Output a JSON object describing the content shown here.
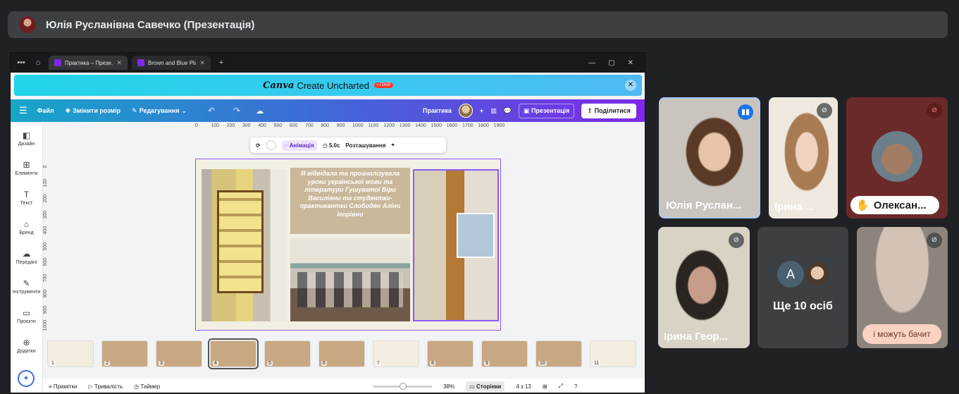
{
  "meet": {
    "presenter_title": "Юлія Русланівна Савечко (Презентація)"
  },
  "browser": {
    "tabs": [
      {
        "label": "Практика – Презе..."
      },
      {
        "label": "Brown and Blue Pla..."
      }
    ]
  },
  "promo": {
    "brand": "Canva",
    "text": "Create Uncharted",
    "badge": "• ГРАЙ"
  },
  "canva_toolbar": {
    "file": "Файл",
    "resize": "Змінити розмір",
    "edit": "Редагування",
    "doc_name": "Практика",
    "present": "Презентація",
    "share": "Поділитися"
  },
  "sidebar": {
    "items": [
      {
        "label": "Дизайн",
        "icon": "design-icon"
      },
      {
        "label": "Елементи",
        "icon": "elements-icon"
      },
      {
        "label": "Текст",
        "icon": "text-icon"
      },
      {
        "label": "Бренд",
        "icon": "brand-icon"
      },
      {
        "label": "Передані",
        "icon": "uploads-icon"
      },
      {
        "label": "Інструменти",
        "icon": "tools-icon"
      },
      {
        "label": "Проєкти",
        "icon": "projects-icon"
      },
      {
        "label": "Додатки",
        "icon": "apps-icon"
      }
    ]
  },
  "ruler": {
    "h": [
      "0",
      "100",
      "200",
      "300",
      "400",
      "500",
      "600",
      "700",
      "800",
      "900",
      "1000",
      "1100",
      "1200",
      "1300",
      "1400",
      "1500",
      "1600",
      "1700",
      "1800",
      "1900"
    ],
    "v": [
      "0",
      "100",
      "200",
      "300",
      "400",
      "500",
      "600",
      "700",
      "800",
      "900",
      "1000"
    ]
  },
  "context_toolbar": {
    "animation": "Анімація",
    "duration": "5.0с",
    "position": "Розташування"
  },
  "slide": {
    "text": "Я відвідала та проаналізувала уроки української мови та літератури Гушуватої Віри Василівни та студентки-практикантки Слободян Аліни Ігорівни"
  },
  "filmstrip": {
    "slides": [
      "1",
      "2",
      "3",
      "4",
      "5",
      "6",
      "7",
      "8",
      "9",
      "10",
      "11"
    ],
    "selected": 4
  },
  "canva_footer": {
    "notes": "Примітки",
    "duration": "Тривалість",
    "timer": "Таймер",
    "zoom": "38%",
    "pages": "Сторінки",
    "page_count": "4 з 13"
  },
  "participants": [
    {
      "name": "Юлія Руслан...",
      "status": "speaking"
    },
    {
      "name": "Ірина ...",
      "status": "muted"
    },
    {
      "name": "Олексан...",
      "status": "muted-hand-raised"
    },
    {
      "name": "Ірина Геор...",
      "status": "muted"
    },
    {
      "name": "",
      "avatar_letter": "A",
      "more": "Ще 10 осіб"
    },
    {
      "name": "",
      "status": "muted",
      "toast": "і можуть бачит"
    }
  ]
}
